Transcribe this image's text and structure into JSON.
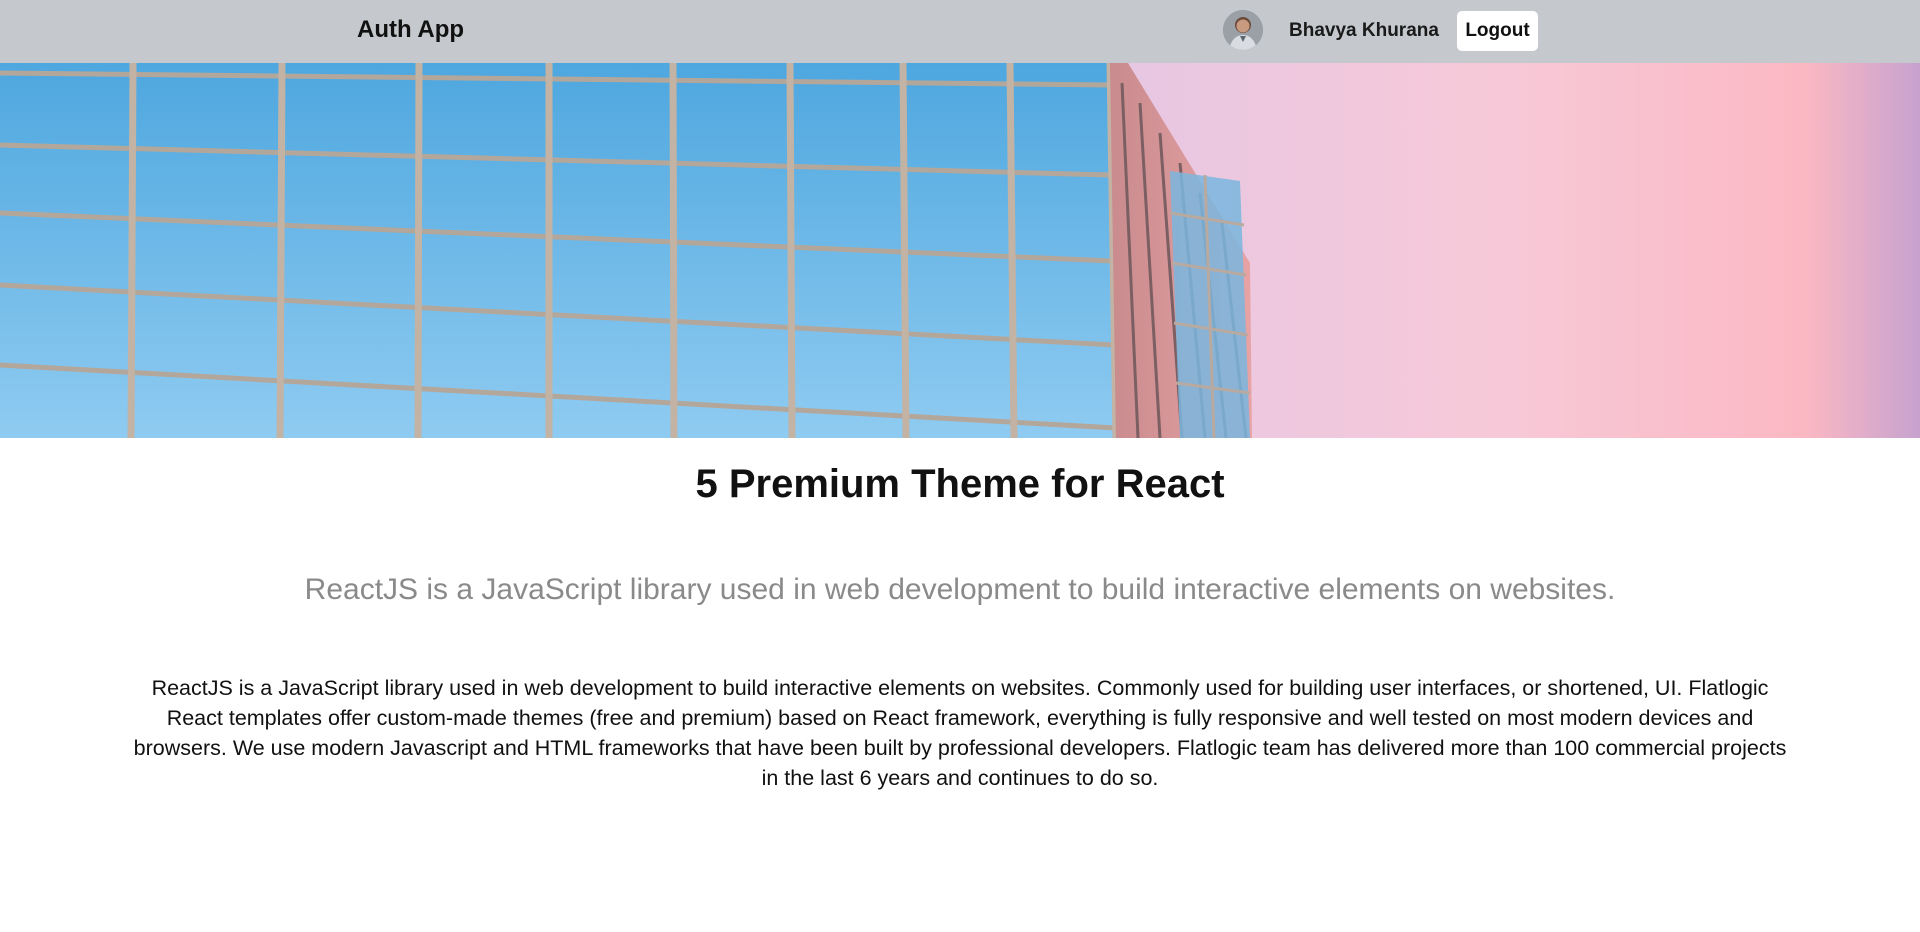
{
  "navbar": {
    "brand": "Auth App",
    "user_name": "Bhavya Khurana",
    "logout_label": "Logout"
  },
  "article": {
    "title": "5 Premium Theme for React",
    "subtitle": "ReactJS is a JavaScript library used in web development to build interactive elements on websites.",
    "body": "ReactJS is a JavaScript library used in web development to build interactive elements on websites. Commonly used for building user interfaces, or shortened, UI. Flatlogic React templates offer custom-made themes (free and premium) based on React framework, everything is fully responsive and well tested on most modern devices and browsers. We use modern Javascript and HTML frameworks that have been built by professional developers. Flatlogic team has delivered more than 100 commercial projects in the last 6 years and continues to do so."
  },
  "colors": {
    "navbar_bg": "#c5c9ce",
    "sky": "#7fc0ea",
    "pink_sky": "#f4b9cd",
    "subtitle": "#8a8a8a"
  },
  "icons": {
    "avatar": "user-avatar-photo",
    "hero": "glass-building-photo"
  }
}
